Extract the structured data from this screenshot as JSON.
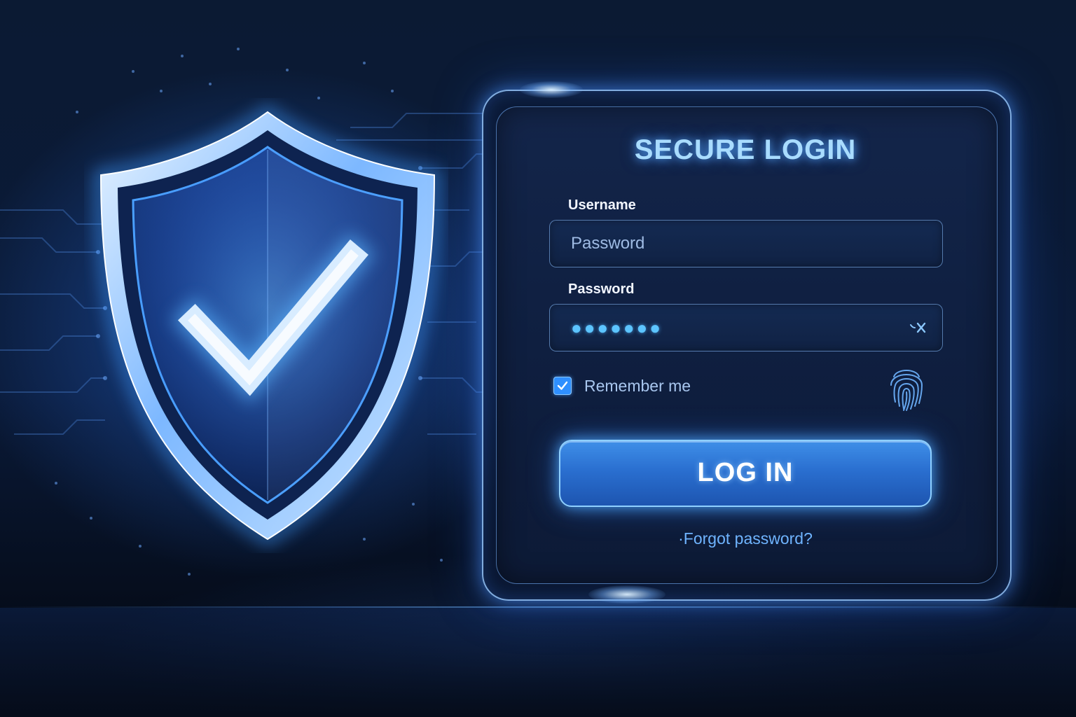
{
  "login": {
    "title": "SECURE LOGIN",
    "username_label": "Username",
    "username_placeholder": "Password",
    "password_label": "Password",
    "password_value": "●●●●●●●",
    "password_toggle_icon": "eye-slash-icon",
    "remember_label": "Remember me",
    "remember_checked": true,
    "fingerprint_icon": "fingerprint-icon",
    "login_button_label": "LOG IN",
    "forgot_link": "·Forgot password?"
  },
  "illustration": {
    "shield_icon": "shield-check-icon"
  },
  "colors": {
    "background": "#0a1a38",
    "accent": "#3f8fe8",
    "glow": "#8fd0ff",
    "title_text": "#a9dcff",
    "link": "#6fb4ff"
  }
}
